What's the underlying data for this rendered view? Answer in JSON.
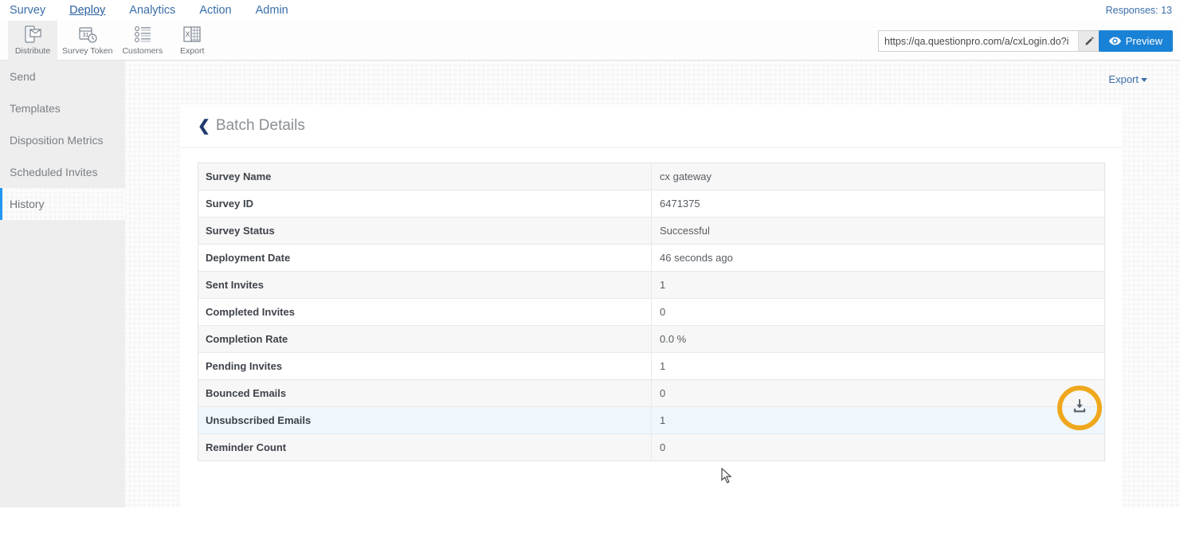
{
  "topnav": {
    "items": [
      {
        "label": "Survey",
        "active": false
      },
      {
        "label": "Deploy",
        "active": true
      },
      {
        "label": "Analytics",
        "active": false
      },
      {
        "label": "Action",
        "active": false
      },
      {
        "label": "Admin",
        "active": false
      }
    ],
    "responses_label": "Responses: 13"
  },
  "toolbar": {
    "tools": [
      {
        "label": "Distribute",
        "icon": "phone-envelope-icon",
        "selected": true
      },
      {
        "label": "Survey Token",
        "icon": "calendar-clock-icon",
        "selected": false
      },
      {
        "label": "Customers",
        "icon": "people-list-icon",
        "selected": false
      },
      {
        "label": "Export",
        "icon": "excel-sheet-icon",
        "selected": false
      }
    ],
    "url_value": "https://qa.questionpro.com/a/cxLogin.do?i",
    "url_placeholder": "Survey URL",
    "edit_icon": "pencil-icon",
    "preview_label": "Preview",
    "preview_icon": "eye-icon"
  },
  "sidebar": {
    "items": [
      {
        "label": "Send",
        "active": false
      },
      {
        "label": "Templates",
        "active": false
      },
      {
        "label": "Disposition Metrics",
        "active": false
      },
      {
        "label": "Scheduled Invites",
        "active": false
      },
      {
        "label": "History",
        "active": true
      }
    ]
  },
  "content": {
    "export_label": "Export",
    "export_caret_icon": "caret-down-icon",
    "card_title": "Batch Details",
    "back_icon": "chevron-left-icon",
    "download_icon": "download-icon",
    "rows": [
      {
        "key": "Survey Name",
        "value": "cx gateway"
      },
      {
        "key": "Survey ID",
        "value": "6471375"
      },
      {
        "key": "Survey Status",
        "value": "Successful"
      },
      {
        "key": "Deployment Date",
        "value": "46 seconds ago"
      },
      {
        "key": "Sent Invites",
        "value": "1"
      },
      {
        "key": "Completed Invites",
        "value": "0"
      },
      {
        "key": "Completion Rate",
        "value": "0.0 %"
      },
      {
        "key": "Pending Invites",
        "value": "1"
      },
      {
        "key": "Bounced Emails",
        "value": "0"
      },
      {
        "key": "Unsubscribed Emails",
        "value": "1",
        "hovered": true
      },
      {
        "key": "Reminder Count",
        "value": "0"
      }
    ]
  },
  "colors": {
    "accent_blue": "#1a82d6",
    "link_blue": "#3a6ea8",
    "highlight_orange": "#efa81e",
    "row_hover": "#eff7fd",
    "sidebar_bg": "#eeeeee"
  }
}
